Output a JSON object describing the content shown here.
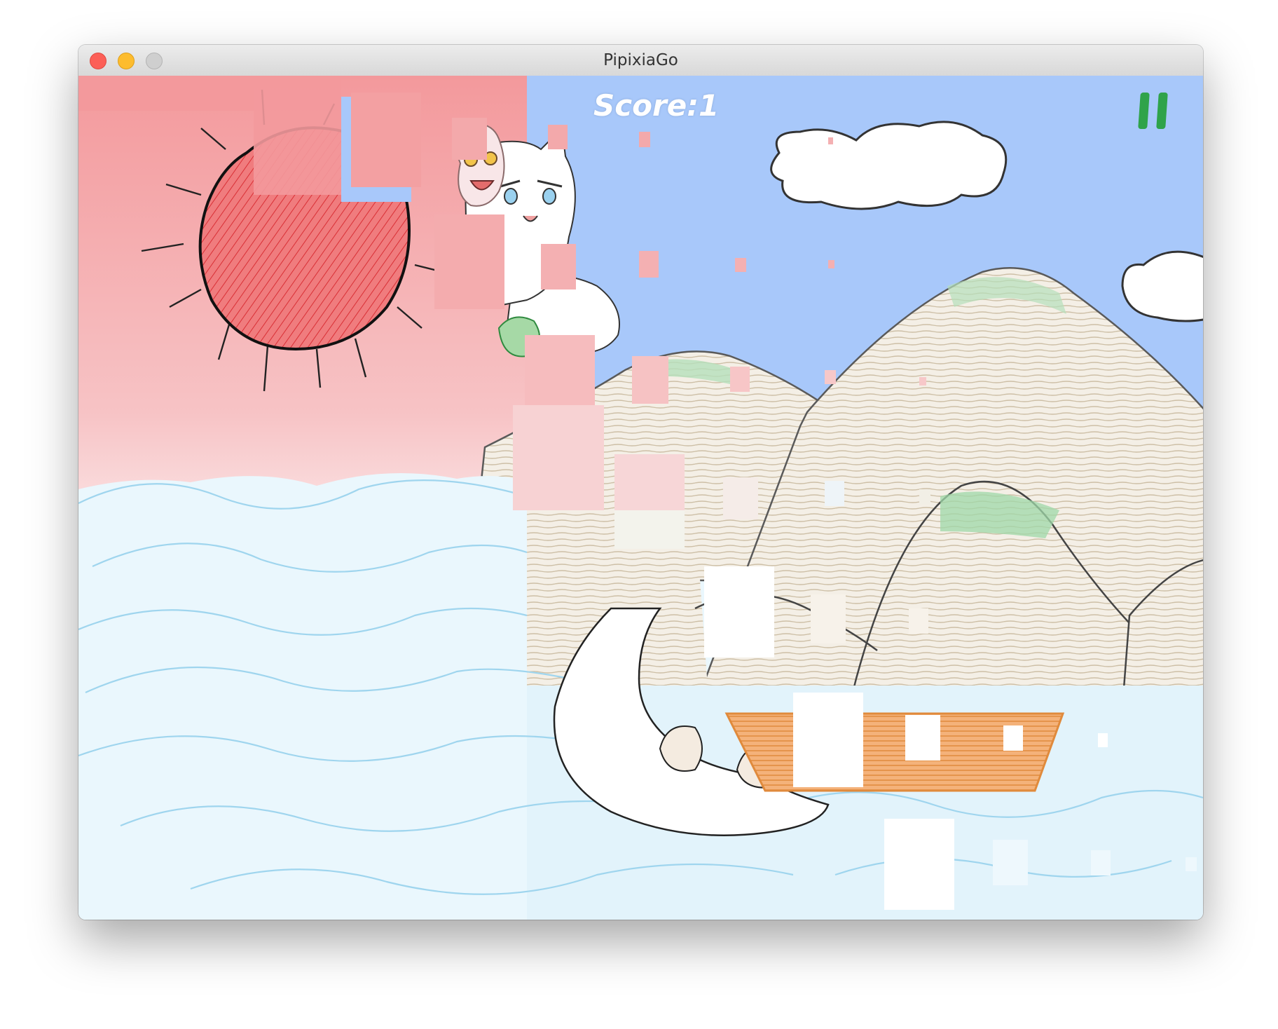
{
  "window": {
    "title": "PipixiaGo"
  },
  "hud": {
    "score_text": "Score:1"
  },
  "icons": {
    "pause": "pause-icon"
  },
  "colors": {
    "sky": "#a8c8fa",
    "sun_glow": "#f3a0a2",
    "sun": "#e34b4b",
    "sea": "#eaf7fd",
    "wave": "#9fd5ee",
    "mountain": "#f2ede3",
    "hatch": "#cbbfa9",
    "grass": "#7cc88a",
    "boat": "#f0a062",
    "pause": "#2fa34a",
    "glitch": "#f3a9ab"
  }
}
